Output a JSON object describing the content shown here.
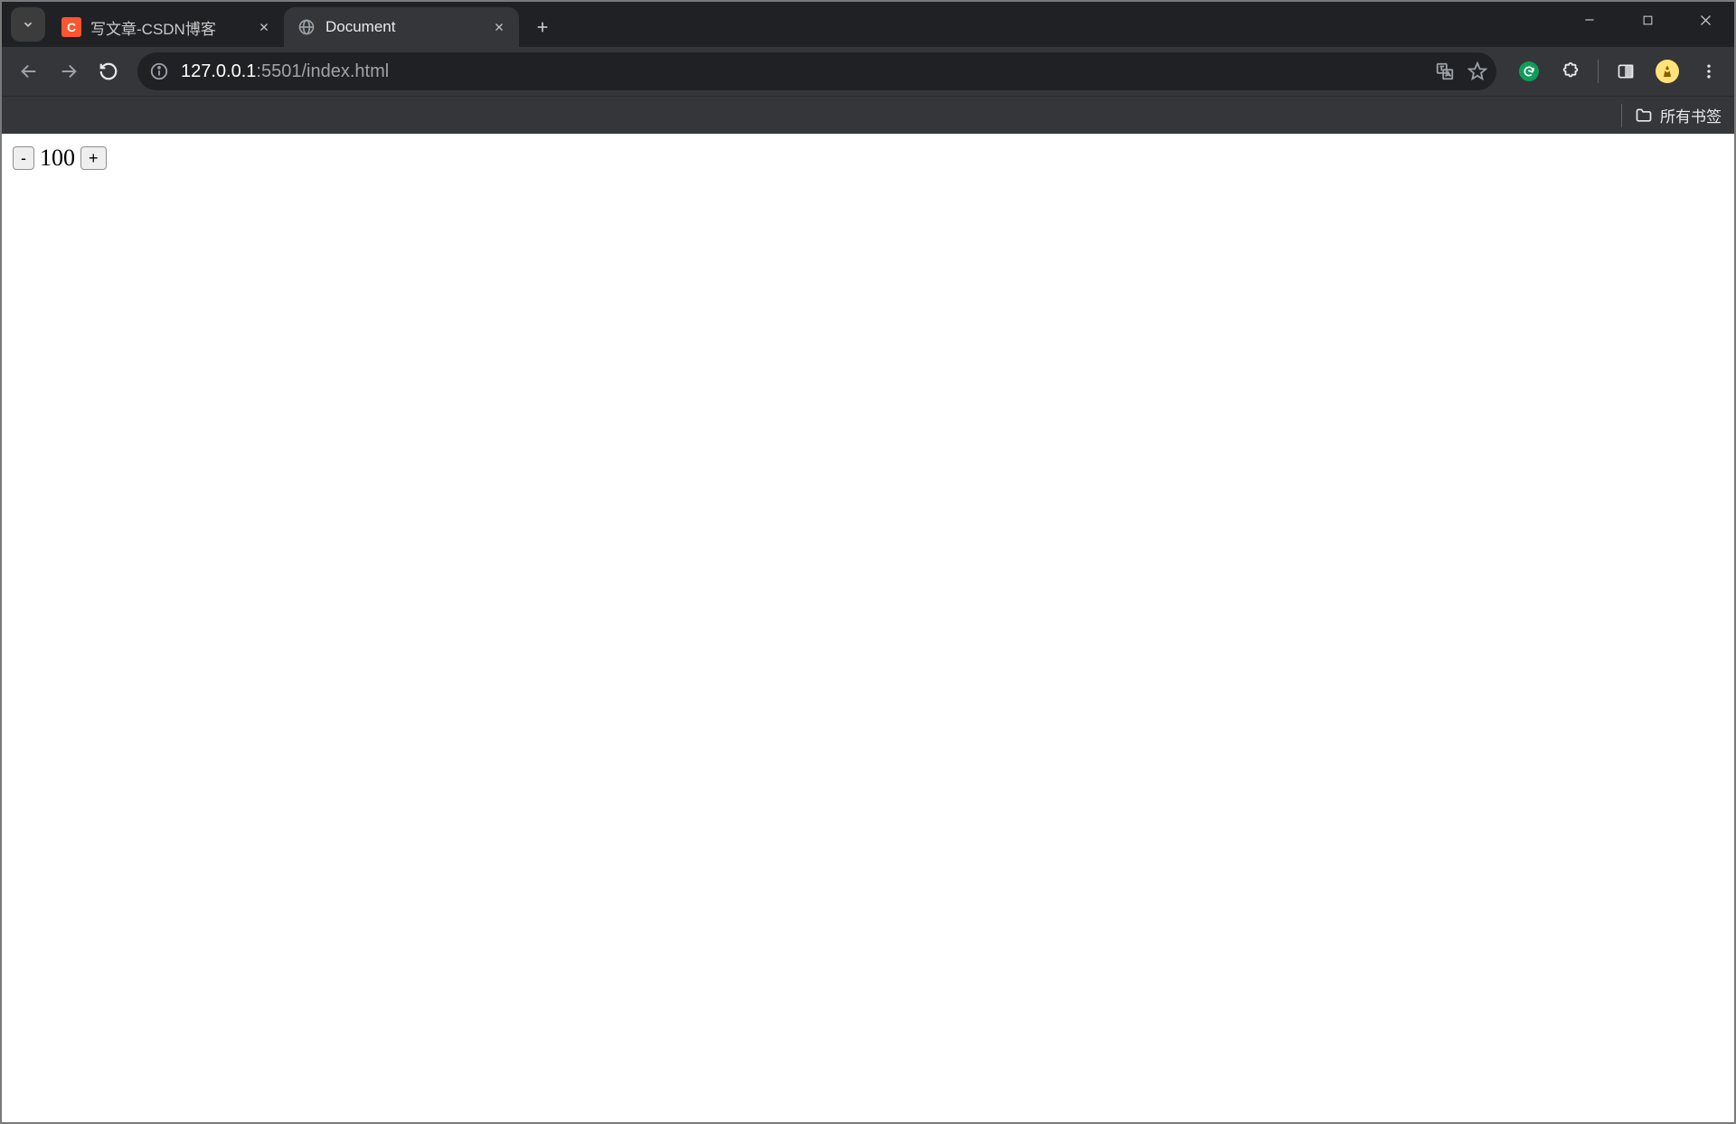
{
  "tabs": [
    {
      "title": "写文章-CSDN博客",
      "favicon": "csdn",
      "favicon_letter": "C",
      "active": false
    },
    {
      "title": "Document",
      "favicon": "globe",
      "active": true
    }
  ],
  "address": {
    "host": "127.0.0.1",
    "port_path": ":5501/index.html"
  },
  "bookmarks": {
    "all_label": "所有书签"
  },
  "page": {
    "counter": {
      "decrement_label": "-",
      "increment_label": "+",
      "value": "100"
    }
  }
}
